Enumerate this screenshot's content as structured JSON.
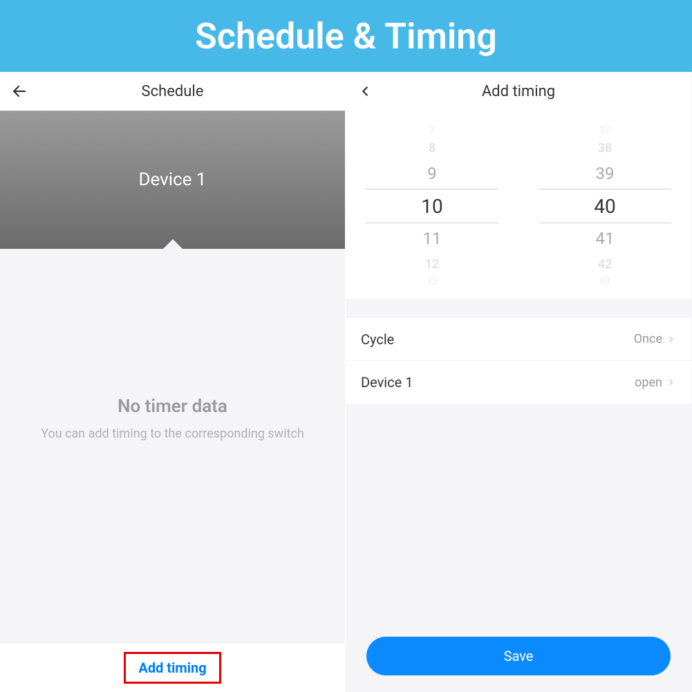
{
  "banner_title": "Schedule & Timing",
  "left": {
    "nav_title": "Schedule",
    "device_name": "Device 1",
    "empty_title": "No timer data",
    "empty_subtitle": "You can add timing to the corresponding switch",
    "add_button_label": "Add timing"
  },
  "right": {
    "nav_title": "Add timing",
    "picker": {
      "hours": [
        "7",
        "8",
        "9",
        "10",
        "11",
        "12",
        "13"
      ],
      "minutes": [
        "37",
        "38",
        "39",
        "40",
        "41",
        "42",
        "43"
      ],
      "selected_hour": "10",
      "selected_minute": "40"
    },
    "options": [
      {
        "label": "Cycle",
        "value": "Once"
      },
      {
        "label": "Device 1",
        "value": "open"
      }
    ],
    "save_label": "Save"
  }
}
